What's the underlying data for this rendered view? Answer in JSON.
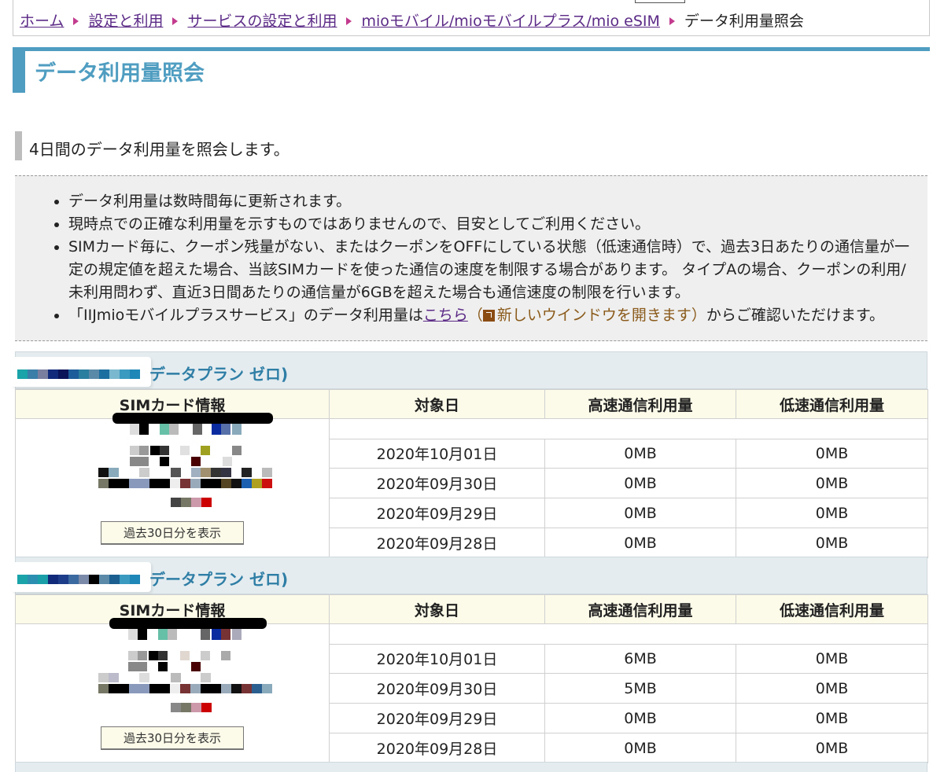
{
  "breadcrumb": {
    "items": [
      "ホーム",
      "設定と利用",
      "サービスの設定と利用",
      "mioモバイル/mioモバイルプラス/mio eSIM"
    ],
    "current": "データ利用量照会"
  },
  "page": {
    "title": "データ利用量照会",
    "lead": "4日間のデータ利用量を照会します。"
  },
  "notes": {
    "items": [
      "データ利用量は数時間毎に更新されます。",
      "現時点での正確な利用量を示すものではありませんので、目安としてご利用ください。",
      "SIMカード毎に、クーポン残量がない、またはクーポンをOFFにしている状態（低速通信時）で、過去3日あたりの通信量が一定の規定値を超えた場合、当該SIMカードを使った通信の速度を制限する場合があります。 タイプAの場合、クーポンの利用/未利用問わず、直近3日間あたりの通信量が6GBを超えた場合も通信速度の制限を行います。"
    ],
    "last_prefix": "「IIJmioモバイルプラスサービス」のデータ利用量は",
    "last_link": "こちら",
    "last_newwin": "新しいウインドウを開きます",
    "last_suffix": "からご確認いただけます。"
  },
  "table_headers": {
    "sim": "SIMカード情報",
    "date": "対象日",
    "high": "高速通信利用量",
    "low": "低速通信利用量"
  },
  "plans": [
    {
      "plan_name": "データプラン ゼロ)",
      "button_label": "過去30日分を表示",
      "rows": [
        {
          "date": "2020年10月01日",
          "high": "0MB",
          "low": "0MB"
        },
        {
          "date": "2020年09月30日",
          "high": "0MB",
          "low": "0MB"
        },
        {
          "date": "2020年09月29日",
          "high": "0MB",
          "low": "0MB"
        },
        {
          "date": "2020年09月28日",
          "high": "0MB",
          "low": "0MB"
        }
      ]
    },
    {
      "plan_name": "データプラン ゼロ)",
      "button_label": "過去30日分を表示",
      "rows": [
        {
          "date": "2020年10月01日",
          "high": "6MB",
          "low": "0MB"
        },
        {
          "date": "2020年09月30日",
          "high": "5MB",
          "low": "0MB"
        },
        {
          "date": "2020年09月29日",
          "high": "0MB",
          "low": "0MB"
        },
        {
          "date": "2020年09月28日",
          "high": "0MB",
          "low": "0MB"
        }
      ]
    }
  ],
  "colors": {
    "accent": "#4f9dc0",
    "plan_text": "#2f7ea6",
    "link": "#5b2a86",
    "header_bg": "#fcfae8"
  }
}
